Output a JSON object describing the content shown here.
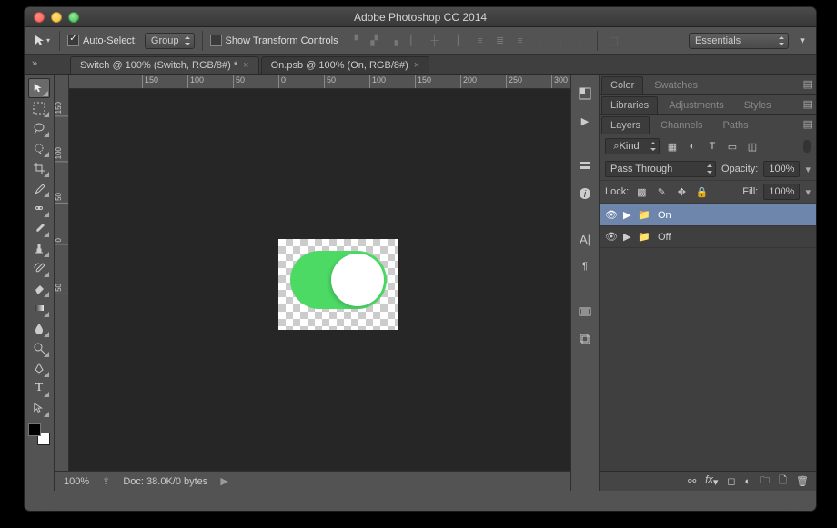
{
  "title": "Adobe Photoshop CC 2014",
  "options": {
    "autoSelectLabel": "Auto-Select:",
    "autoSelectChecked": true,
    "autoSelectMode": "Group",
    "showTransformLabel": "Show Transform Controls",
    "showTransformChecked": false,
    "workspace": "Essentials"
  },
  "tabs": [
    {
      "label": "Switch @ 100% (Switch, RGB/8#) *",
      "active": false
    },
    {
      "label": "On.psb @ 100% (On, RGB/8#)",
      "active": true
    }
  ],
  "hruler": [
    "150",
    "100",
    "50",
    "0",
    "50",
    "100",
    "150",
    "200",
    "250",
    "300"
  ],
  "vruler": [
    "150",
    "100",
    "50",
    "0",
    "50"
  ],
  "status": {
    "zoom": "100%",
    "doc": "Doc: 38.0K/0 bytes"
  },
  "colorPanel": {
    "tabs": [
      "Color",
      "Swatches"
    ]
  },
  "libPanel": {
    "tabs": [
      "Libraries",
      "Adjustments",
      "Styles"
    ]
  },
  "layersPanel": {
    "tabs": [
      "Layers",
      "Channels",
      "Paths"
    ],
    "filterMode": "Kind",
    "blendMode": "Pass Through",
    "opacityLabel": "Opacity:",
    "opacity": "100%",
    "lockLabel": "Lock:",
    "fillLabel": "Fill:",
    "fill": "100%",
    "layers": [
      {
        "name": "On",
        "selected": true
      },
      {
        "name": "Off",
        "selected": false
      }
    ]
  },
  "searchPrefix": "⌕"
}
